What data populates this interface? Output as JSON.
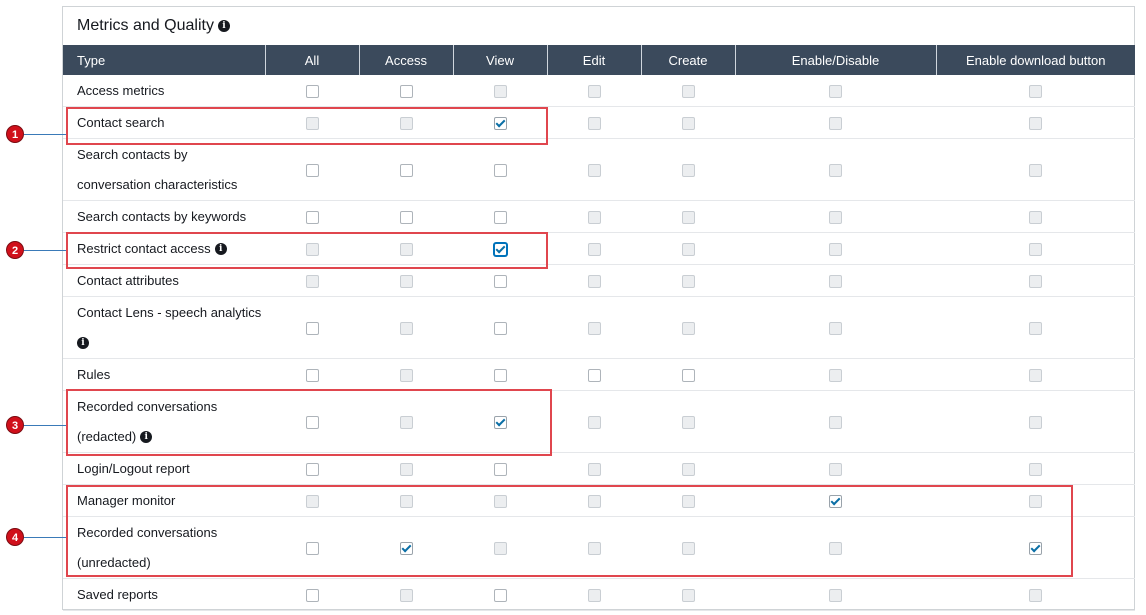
{
  "panel": {
    "title": "Metrics and Quality",
    "info_glyph": "i"
  },
  "columns": [
    "Type",
    "All",
    "Access",
    "View",
    "Edit",
    "Create",
    "Enable/Disable",
    "Enable download button"
  ],
  "rows": [
    {
      "label": [
        "Access metrics"
      ],
      "info": false,
      "states": [
        "u",
        "u",
        "d",
        "d",
        "d",
        "d",
        "d"
      ]
    },
    {
      "label": [
        "Contact search"
      ],
      "info": false,
      "states": [
        "d",
        "d",
        "c",
        "d",
        "d",
        "d",
        "d"
      ]
    },
    {
      "label": [
        "Search contacts by",
        "conversation characteristics"
      ],
      "info": false,
      "states": [
        "u",
        "u",
        "u",
        "d",
        "d",
        "d",
        "d"
      ]
    },
    {
      "label": [
        "Search contacts by keywords"
      ],
      "info": false,
      "states": [
        "u",
        "u",
        "u",
        "d",
        "d",
        "d",
        "d"
      ]
    },
    {
      "label": [
        "Restrict contact access"
      ],
      "info": true,
      "states": [
        "d",
        "d",
        "cf",
        "d",
        "d",
        "d",
        "d"
      ]
    },
    {
      "label": [
        "Contact attributes"
      ],
      "info": false,
      "states": [
        "d",
        "d",
        "u",
        "d",
        "d",
        "d",
        "d"
      ]
    },
    {
      "label": [
        "Contact Lens - speech analytics",
        ""
      ],
      "info": true,
      "states": [
        "u",
        "d",
        "u",
        "d",
        "d",
        "d",
        "d"
      ]
    },
    {
      "label": [
        "Rules"
      ],
      "info": false,
      "states": [
        "u",
        "d",
        "u",
        "u",
        "u",
        "d",
        "d"
      ]
    },
    {
      "label": [
        "Recorded conversations",
        "(redacted)"
      ],
      "info": true,
      "states": [
        "u",
        "d",
        "c",
        "d",
        "d",
        "d",
        "d"
      ]
    },
    {
      "label": [
        "Login/Logout report"
      ],
      "info": false,
      "states": [
        "u",
        "d",
        "u",
        "d",
        "d",
        "d",
        "d"
      ]
    },
    {
      "label": [
        "Manager monitor"
      ],
      "info": false,
      "states": [
        "d",
        "d",
        "d",
        "d",
        "d",
        "c",
        "d"
      ]
    },
    {
      "label": [
        "Recorded conversations",
        "(unredacted)"
      ],
      "info": false,
      "states": [
        "u",
        "c",
        "d",
        "d",
        "d",
        "d",
        "c"
      ]
    },
    {
      "label": [
        "Saved reports"
      ],
      "info": false,
      "states": [
        "u",
        "d",
        "u",
        "d",
        "d",
        "d",
        "d"
      ]
    }
  ],
  "callouts": [
    "1",
    "2",
    "3",
    "4"
  ]
}
